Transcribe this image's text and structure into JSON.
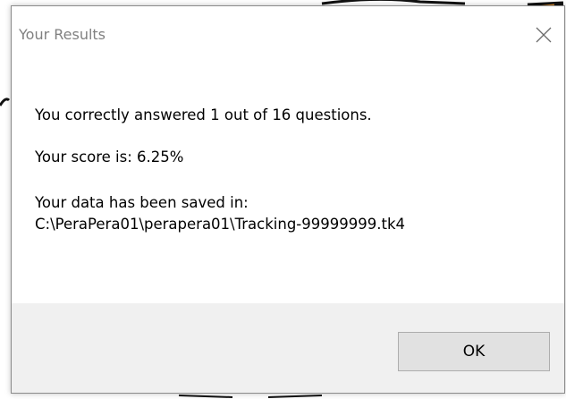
{
  "dialog": {
    "title": "Your Results",
    "close_icon": "close-icon",
    "message_correct": "You correctly answered 1 out of 16 questions.",
    "message_score": "Your score is: 6.25%",
    "message_saved_label": "Your data has been saved in:",
    "message_saved_path": "C:\\PeraPera01\\perapera01\\Tracking-99999999.tk4",
    "ok_label": "OK"
  },
  "colors": {
    "title_text": "#808080",
    "footer_bg": "#f0f0f0",
    "button_bg": "#e1e1e1",
    "button_border": "#adadad"
  }
}
